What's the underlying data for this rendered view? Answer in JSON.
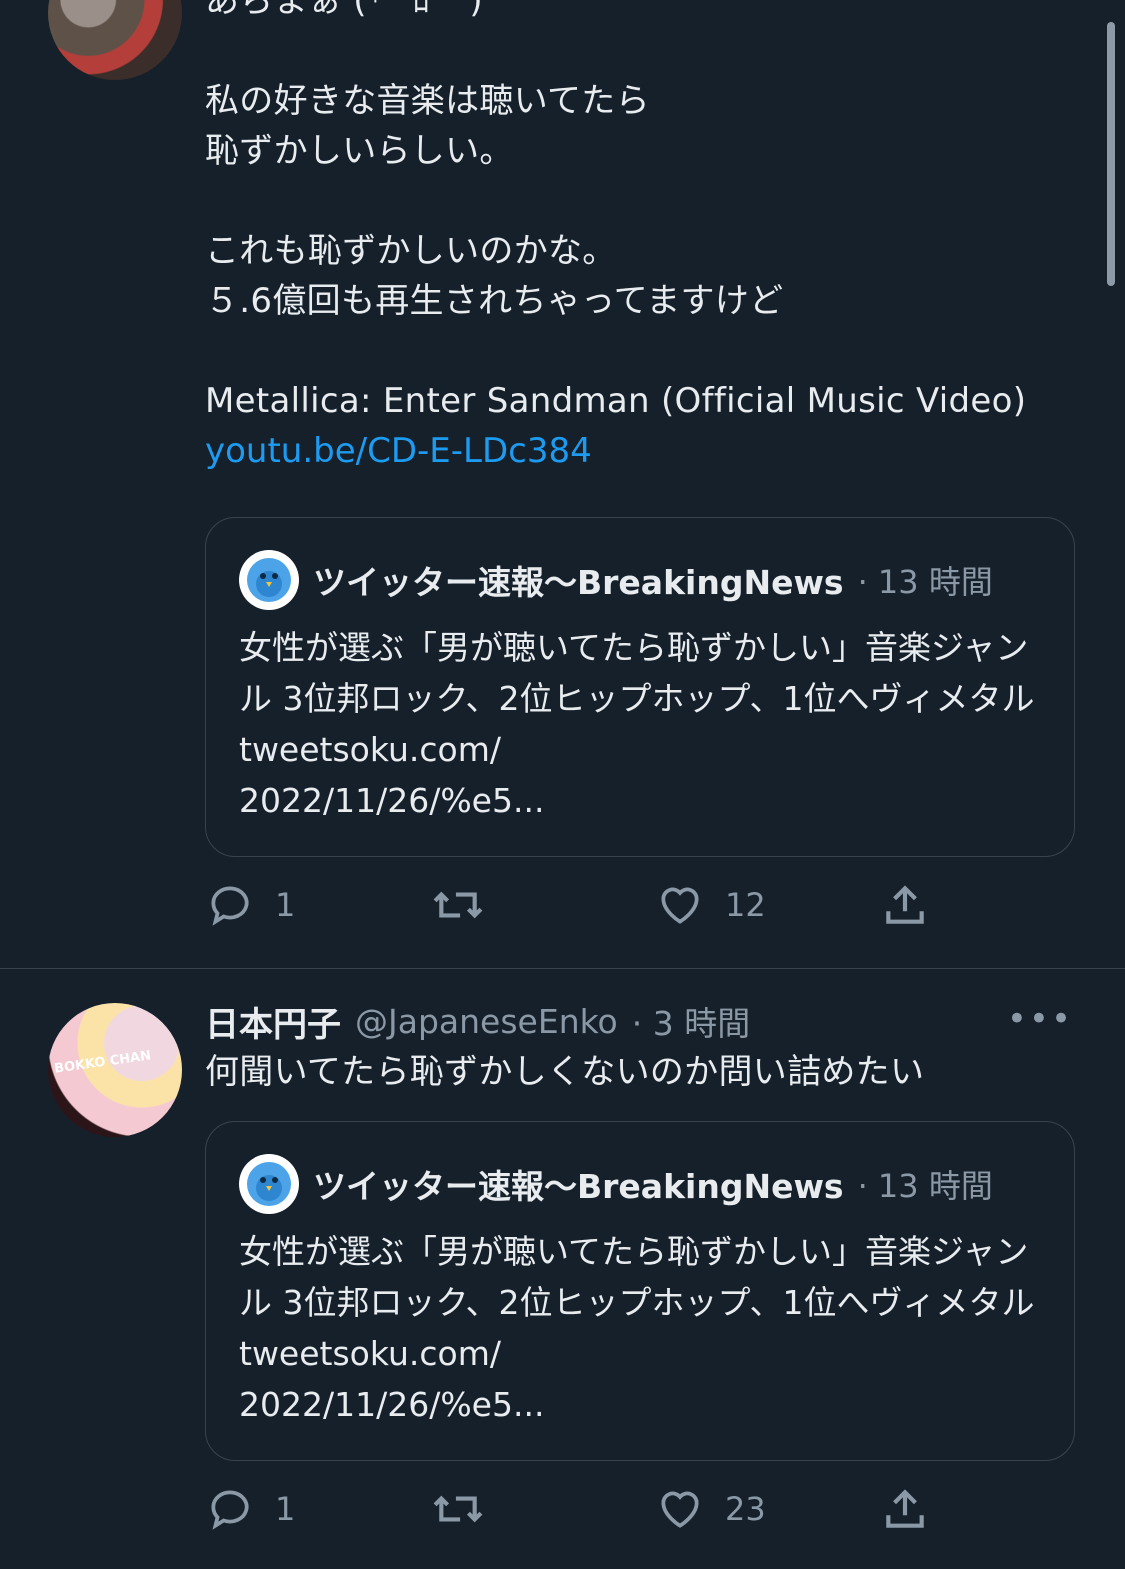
{
  "tweet1": {
    "body": "あらまぁ (*´ ﾛ ` )\n\n私の好きな音楽は聴いてたら\n恥ずかしいらしい。\n\nこれも恥ずかしいのかな。\n５.6億回も再生されちゃってますけど\n\nMetallica: Enter Sandman (Official Music Video)",
    "link": "youtu.be/CD-E-LDc384",
    "quote": {
      "name": "ツイッター速報〜BreakingNews",
      "time": "· 13 時間",
      "text": "女性が選ぶ「男が聴いてたら恥ずかしい」音楽ジャンル 3位邦ロック、2位ヒップホップ、1位へヴィメタル tweetsoku.com/\n2022/11/26/%e5..."
    },
    "actions": {
      "reply_count": "1",
      "retweet_count": "",
      "like_count": "12"
    }
  },
  "tweet2": {
    "name": "日本円子",
    "handle": "@JapaneseEnko",
    "time": "· 3 時間",
    "avatar_text": "BOKKO CHAN",
    "body": "何聞いてたら恥ずかしくないのか問い詰めたい",
    "more": "•••",
    "quote": {
      "name": "ツイッター速報〜BreakingNews",
      "time": "· 13 時間",
      "text": "女性が選ぶ「男が聴いてたら恥ずかしい」音楽ジャンル 3位邦ロック、2位ヒップホップ、1位へヴィメタル tweetsoku.com/\n2022/11/26/%e5..."
    },
    "actions": {
      "reply_count": "1",
      "retweet_count": "",
      "like_count": "23"
    }
  },
  "colors": {
    "background": "#15202b",
    "text": "#e8ecef",
    "muted": "#8b98a5",
    "link": "#1d9bf0",
    "border": "#38444d"
  },
  "icons": [
    "reply-icon",
    "retweet-icon",
    "like-icon",
    "share-icon",
    "bird-icon",
    "more-icon"
  ]
}
